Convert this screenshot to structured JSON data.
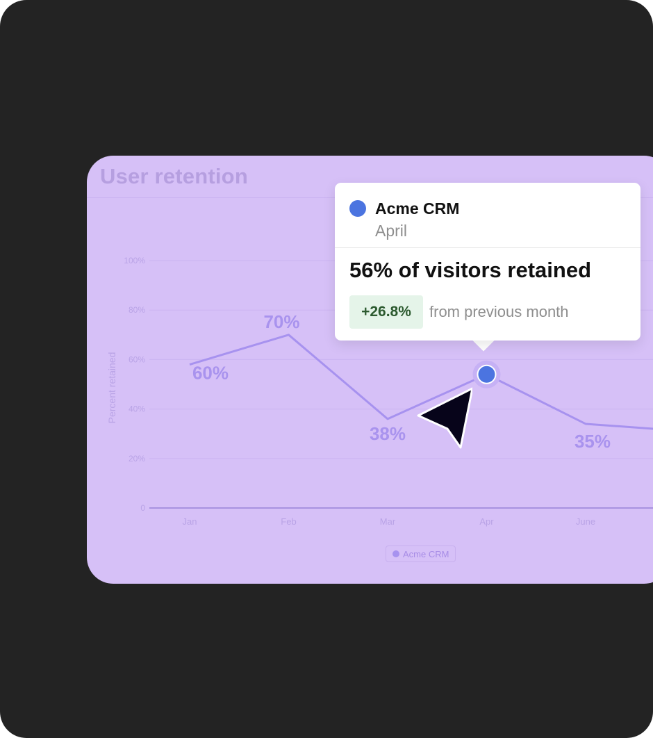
{
  "card": {
    "title": "User retention"
  },
  "chart_data": {
    "type": "line",
    "title": "User retention",
    "xlabel": "",
    "ylabel": "Percent retained",
    "ylim": [
      0,
      100
    ],
    "y_ticks": [
      "0",
      "20%",
      "40%",
      "60%",
      "80%",
      "100%"
    ],
    "y_tick_values": [
      0,
      20,
      40,
      60,
      80,
      100
    ],
    "categories": [
      "Jan",
      "Feb",
      "Mar",
      "Apr",
      "June"
    ],
    "series": [
      {
        "name": "Acme CRM",
        "values": [
          58,
          70,
          36,
          54,
          34
        ],
        "data_labels": [
          "60%",
          "70%",
          "38%",
          "",
          "35%"
        ],
        "color": "#a792ef"
      }
    ],
    "highlighted_category": "Apr",
    "grid": true,
    "legend_position": "bottom-center"
  },
  "legend": {
    "label": "Acme CRM"
  },
  "tooltip": {
    "series": "Acme CRM",
    "month": "April",
    "headline": "56% of visitors retained",
    "change": "+26.8%",
    "change_label": "from previous month",
    "dot_color": "#4b74e0"
  },
  "colors": {
    "frame": "#232323",
    "card": "#d6c0f7",
    "line": "#a792ef",
    "highlight_point": "#4b74e0",
    "badge_bg": "#e5f4e9",
    "badge_text": "#2c5a2f"
  }
}
